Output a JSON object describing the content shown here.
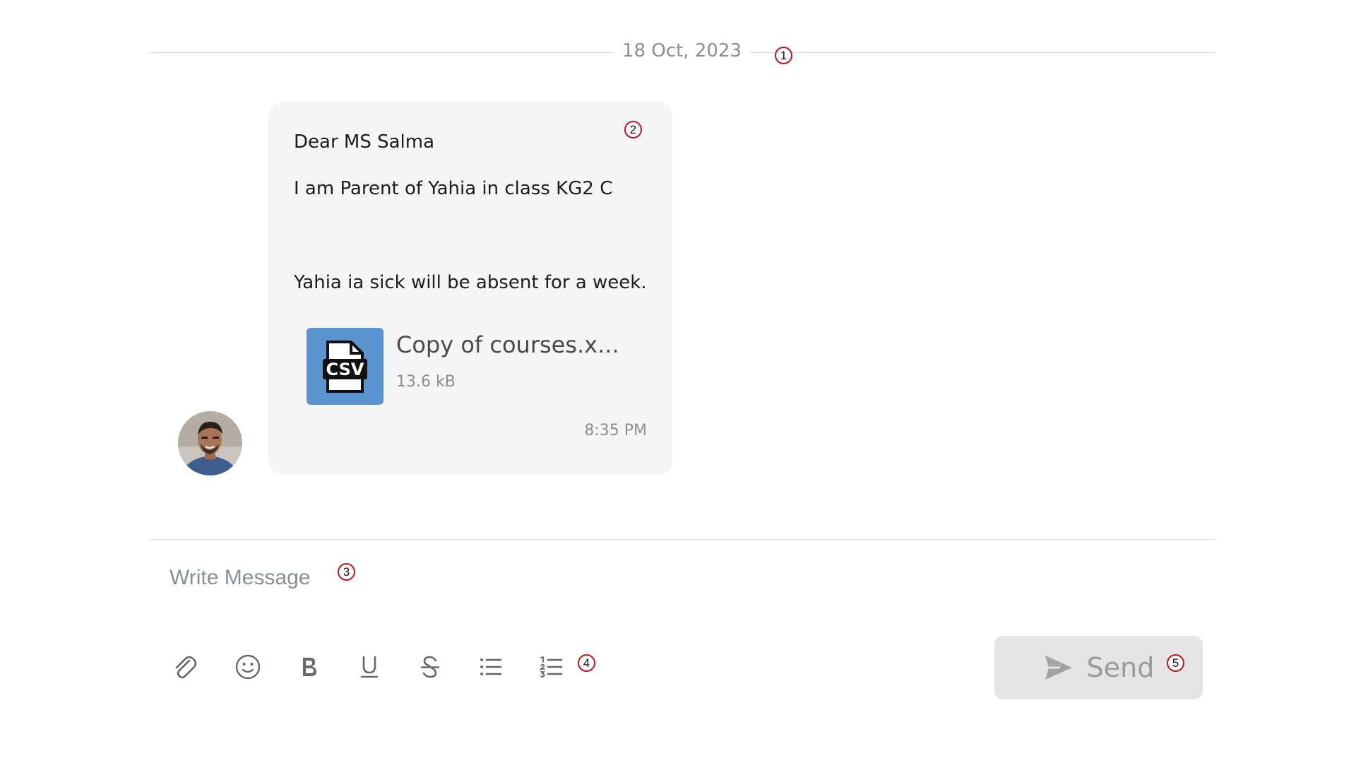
{
  "divider": {
    "date": "18 Oct, 2023"
  },
  "message": {
    "lines": [
      "Dear MS Salma",
      "I am Parent of Yahia in class KG2 C",
      "Yahia ia sick will be absent for a week."
    ],
    "attachment": {
      "icon_label": "CSV",
      "name": "Copy of courses.x...",
      "size": "13.6 kB"
    },
    "time": "8:35 PM"
  },
  "composer": {
    "placeholder": "Write Message",
    "tools": [
      "paperclip-icon",
      "emoji-icon",
      "bold-icon",
      "underline-icon",
      "strikethrough-icon",
      "bullet-list-icon",
      "numbered-list-icon"
    ],
    "send_label": "Send"
  },
  "annotations": [
    "1",
    "2",
    "3",
    "4",
    "5"
  ],
  "colors": {
    "bubble_bg": "#f5f5f5",
    "attachment_bg": "#5b95d0",
    "send_bg": "#e4e4e4",
    "marker": "#c0161c"
  }
}
